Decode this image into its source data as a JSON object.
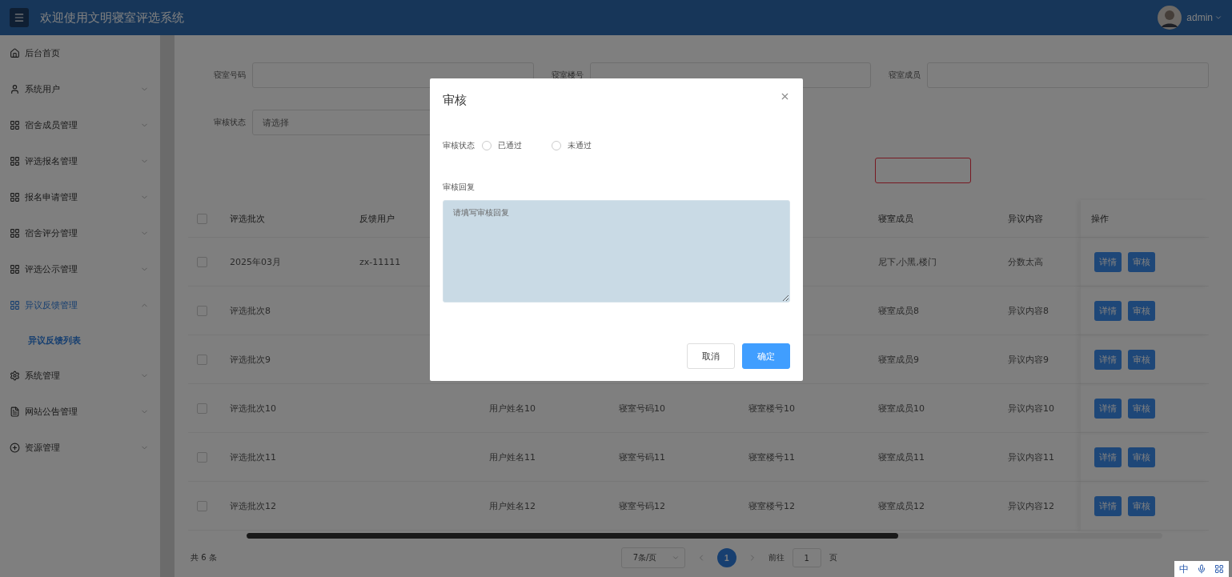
{
  "header": {
    "title": "欢迎使用文明寝室评选系统",
    "user": "admin"
  },
  "sidebar": {
    "items": [
      {
        "label": "后台首页",
        "selected": false,
        "has_children": false
      },
      {
        "label": "系统用户",
        "expanded": false,
        "selected": false,
        "has_children": true
      },
      {
        "label": "宿舍成员管理",
        "expanded": false,
        "selected": false,
        "has_children": true
      },
      {
        "label": "评选报名管理",
        "expanded": false,
        "selected": false,
        "has_children": true
      },
      {
        "label": "报名申请管理",
        "expanded": false,
        "selected": false,
        "has_children": true
      },
      {
        "label": "宿舍评分管理",
        "expanded": false,
        "selected": false,
        "has_children": true
      },
      {
        "label": "评选公示管理",
        "expanded": false,
        "selected": false,
        "has_children": true
      },
      {
        "label": "异议反馈管理",
        "expanded": true,
        "selected": true,
        "has_children": true,
        "children": [
          {
            "label": "异议反馈列表",
            "selected": true
          }
        ]
      },
      {
        "label": "系统管理",
        "expanded": false,
        "selected": false,
        "has_children": true
      },
      {
        "label": "网站公告管理",
        "expanded": false,
        "selected": false,
        "has_children": true
      },
      {
        "label": "资源管理",
        "expanded": false,
        "selected": false,
        "has_children": true
      }
    ]
  },
  "filters": [
    {
      "kind": "input",
      "label": "寝室号码"
    },
    {
      "kind": "input",
      "label": "寝室楼号"
    },
    {
      "kind": "input",
      "label": "寝室成员"
    },
    {
      "kind": "select",
      "label": "审核状态",
      "placeholder": "请选择"
    }
  ],
  "table": {
    "header_checked": false,
    "columns": [
      {
        "label": "评选批次"
      },
      {
        "label": "反馈用户"
      },
      {},
      {},
      {},
      {
        "label": "寝室成员"
      },
      {
        "label": "异议内容"
      },
      {
        "label": "操作"
      }
    ],
    "rows": [
      {
        "checked": false,
        "cells": [
          "2025年03月",
          "zx-11111",
          null,
          null,
          null,
          "尼下,小黑,楼门",
          "分数太高"
        ],
        "actions": [
          "详情",
          "审核"
        ]
      },
      {
        "checked": false,
        "cells": [
          "评选批次8",
          null,
          null,
          null,
          null,
          "寝室成员8",
          "异议内容8"
        ],
        "actions": [
          "详情",
          "审核"
        ]
      },
      {
        "checked": false,
        "cells": [
          "评选批次9",
          null,
          null,
          null,
          null,
          "寝室成员9",
          "异议内容9"
        ],
        "actions": [
          "详情",
          "审核"
        ]
      },
      {
        "checked": false,
        "cells": [
          "评选批次10",
          null,
          "用户姓名10",
          "寝室号码10",
          "寝室楼号10",
          "寝室成员10",
          "异议内容10"
        ],
        "actions": [
          "详情",
          "审核"
        ]
      },
      {
        "checked": false,
        "cells": [
          "评选批次11",
          null,
          "用户姓名11",
          "寝室号码11",
          "寝室楼号11",
          "寝室成员11",
          "异议内容11"
        ],
        "actions": [
          "详情",
          "审核"
        ]
      },
      {
        "checked": false,
        "cells": [
          "评选批次12",
          null,
          "用户姓名12",
          "寝室号码12",
          "寝室楼号12",
          "寝室成员12",
          "异议内容12"
        ],
        "actions": [
          "详情",
          "审核"
        ]
      }
    ]
  },
  "pagination": {
    "total": "共 6 条",
    "page_size": "7条/页",
    "pages": [
      {
        "label": "1",
        "selected": true
      }
    ],
    "goto_label": "前往",
    "goto_value": "1",
    "goto_suffix": "页"
  },
  "dialog": {
    "title": "审核",
    "status_label": "审核状态",
    "options": [
      {
        "label": "已通过",
        "selected": false
      },
      {
        "label": "未通过",
        "selected": false
      }
    ],
    "reply_label": "审核回复",
    "reply_placeholder": "请填写审核回复",
    "buttons": [
      {
        "kind": "default",
        "label": "取消"
      },
      {
        "kind": "primary",
        "label": "确定"
      }
    ]
  },
  "ime": {
    "label": "中"
  }
}
